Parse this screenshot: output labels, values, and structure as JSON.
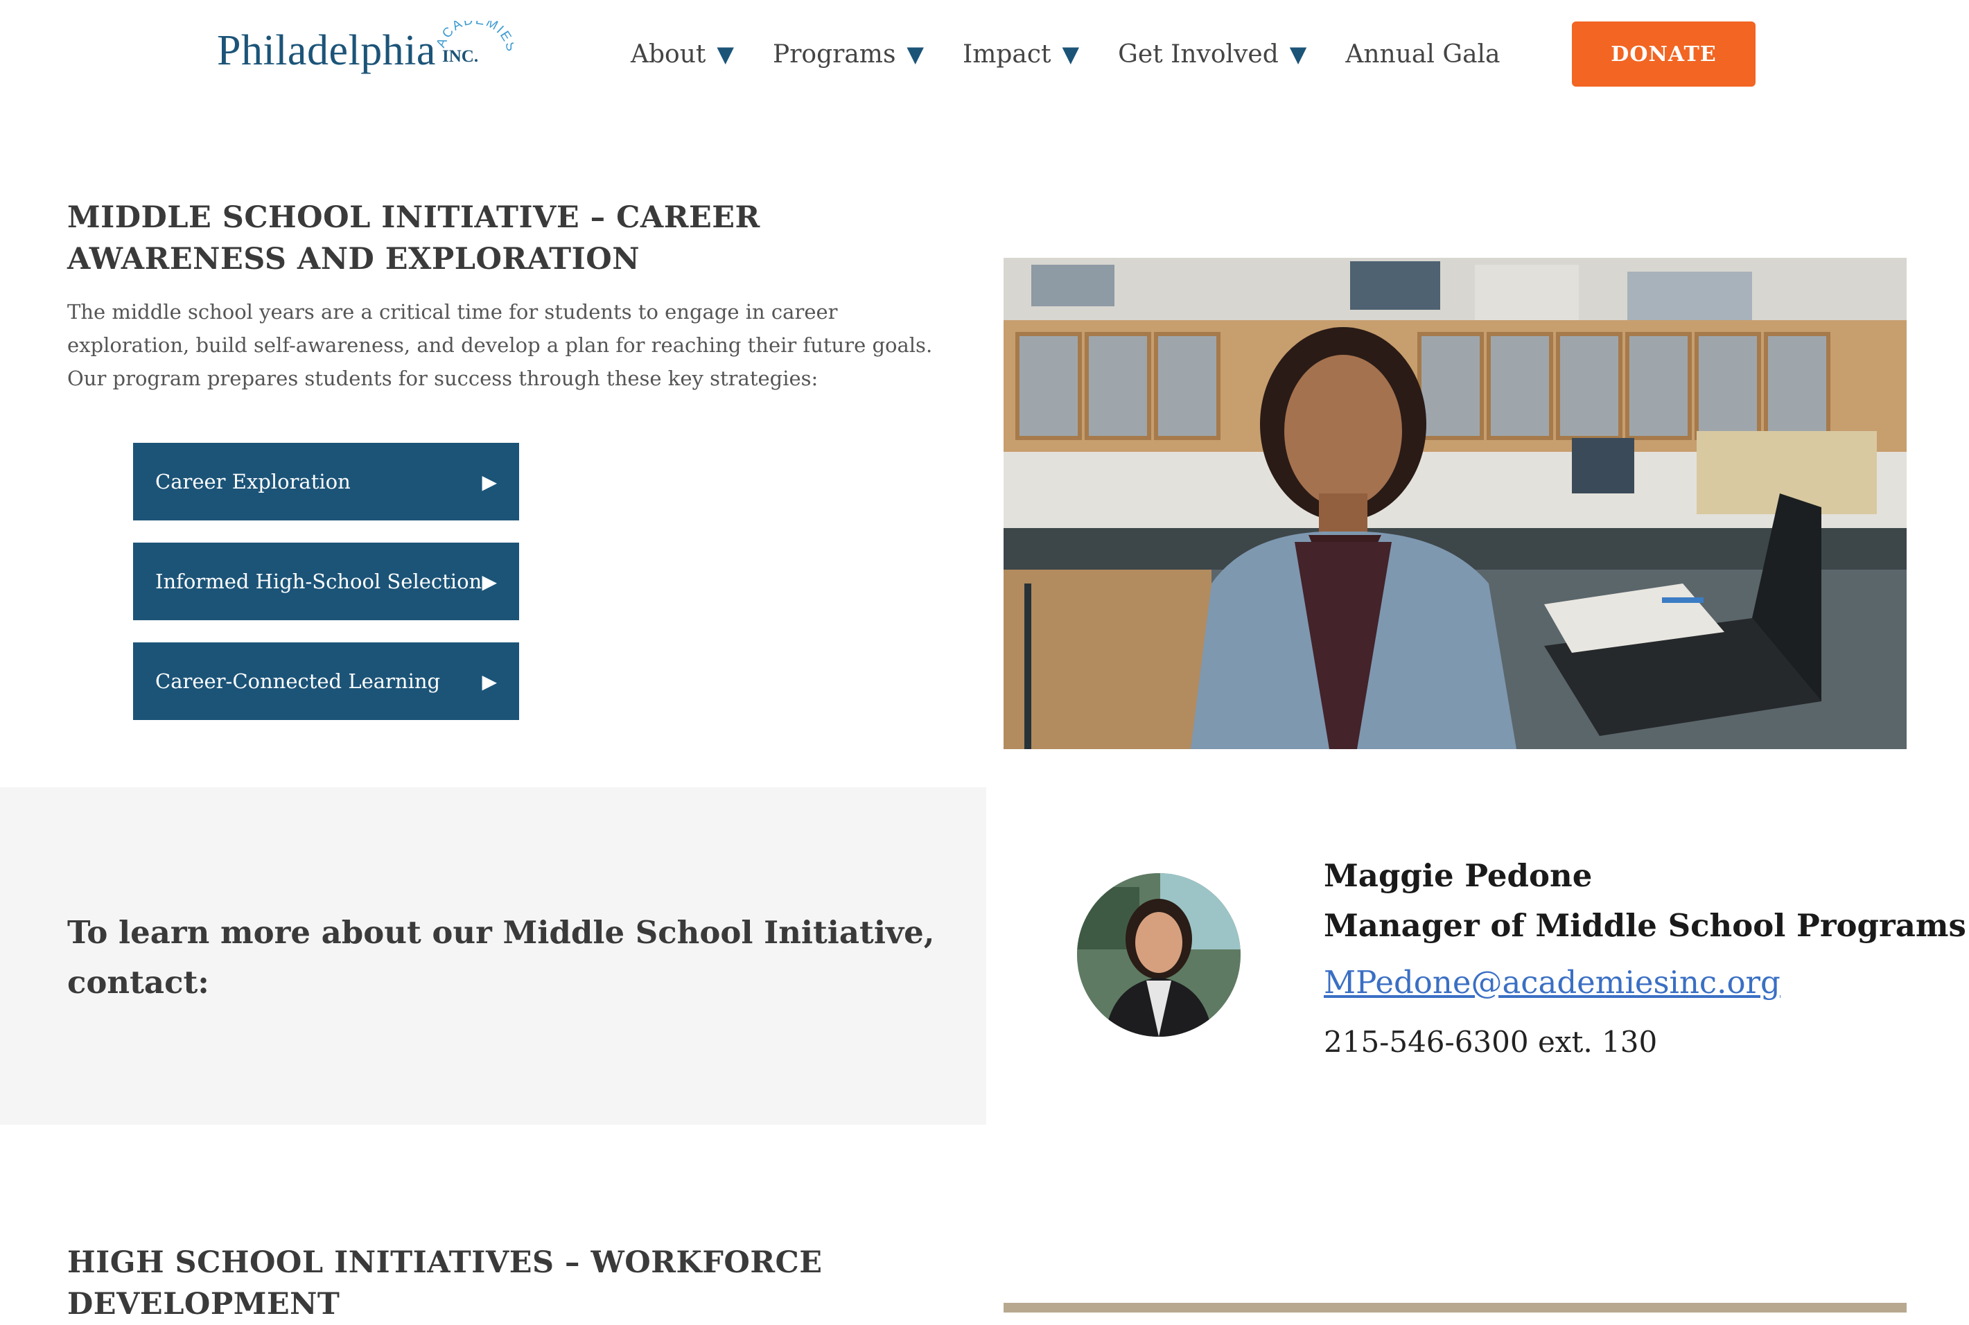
{
  "header": {
    "logo": {
      "main": "Philadelphia",
      "arc": "ACADEMIES",
      "inc": "INC."
    },
    "nav": [
      {
        "label": "About",
        "has_dropdown": true
      },
      {
        "label": "Programs",
        "has_dropdown": true
      },
      {
        "label": "Impact",
        "has_dropdown": true
      },
      {
        "label": "Get Involved",
        "has_dropdown": true
      },
      {
        "label": "Annual Gala",
        "has_dropdown": false
      }
    ],
    "caret": "▼",
    "donate_label": "DONATE"
  },
  "middle_school": {
    "title": "MIDDLE SCHOOL INITIATIVE – CAREER AWARENESS AND EXPLORATION",
    "body": "The middle school years are a critical time for students to engage in career exploration, build self-awareness, and develop a plan for reaching their future goals. Our program prepares students for success through these key strategies:",
    "strategies": [
      {
        "label": "Career Exploration"
      },
      {
        "label": "Informed High-School Selection"
      },
      {
        "label": "Career-Connected Learning"
      }
    ],
    "play_glyph": "▶"
  },
  "contact": {
    "prompt": "To learn more about our Middle School Initiative, contact:",
    "name": "Maggie Pedone",
    "role": "Manager of Middle School Programs",
    "email": "MPedone@academiesinc.org",
    "phone": "215-546-6300 ext. 130"
  },
  "high_school": {
    "title": "HIGH SCHOOL INITIATIVES – WORKFORCE DEVELOPMENT"
  },
  "colors": {
    "brand_blue": "#1c5478",
    "accent_light_blue": "#3f9bd0",
    "donate_orange": "#f26522",
    "link_blue": "#3a6fc4",
    "band_gray": "#f5f5f5"
  }
}
